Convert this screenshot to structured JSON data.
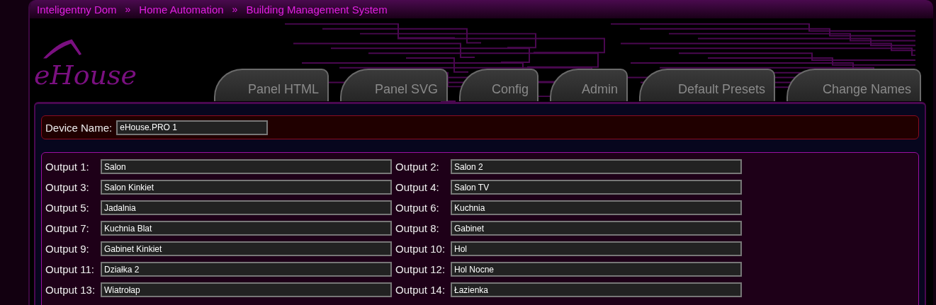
{
  "breadcrumb": [
    {
      "label": "Inteligentny Dom"
    },
    {
      "label": "Home Automation"
    },
    {
      "label": "Building Management System"
    }
  ],
  "breadcrumb_separator": "»",
  "logo": "eHouse",
  "tabs": [
    {
      "label": "Panel HTML"
    },
    {
      "label": "Panel SVG"
    },
    {
      "label": "Config"
    },
    {
      "label": "Admin"
    },
    {
      "label": "Default Presets"
    },
    {
      "label": "Change Names"
    }
  ],
  "device": {
    "label": "Device Name:",
    "value": "eHouse.PRO 1"
  },
  "outputs": [
    {
      "label": "Output 1:",
      "value": "Salon"
    },
    {
      "label": "Output 2:",
      "value": "Salon 2"
    },
    {
      "label": "Output 3:",
      "value": "Salon Kinkiet"
    },
    {
      "label": "Output 4:",
      "value": "Salon TV"
    },
    {
      "label": "Output 5:",
      "value": "Jadalnia"
    },
    {
      "label": "Output 6:",
      "value": "Kuchnia"
    },
    {
      "label": "Output 7:",
      "value": "Kuchnia Blat"
    },
    {
      "label": "Output 8:",
      "value": "Gabinet"
    },
    {
      "label": "Output 9:",
      "value": "Gabinet Kinkiet"
    },
    {
      "label": "Output 10:",
      "value": "Hol"
    },
    {
      "label": "Output 11:",
      "value": "Działka 2"
    },
    {
      "label": "Output 12:",
      "value": "Hol Nocne"
    },
    {
      "label": "Output 13:",
      "value": "Wiatrołap"
    },
    {
      "label": "Output 14:",
      "value": "Łazienka"
    }
  ]
}
